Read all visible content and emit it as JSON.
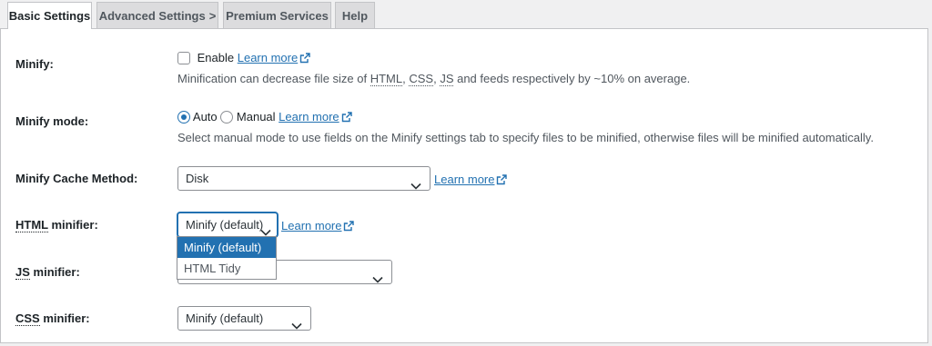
{
  "tabs": {
    "basic": "Basic Settings",
    "advanced": "Advanced Settings",
    "advanced_chevron": ">",
    "premium": "Premium Services",
    "help": "Help"
  },
  "learn_more": "Learn more",
  "minify": {
    "label": "Minify:",
    "enable_label": "Enable",
    "desc_before": "Minification can decrease file size of ",
    "abbr_html": "HTML",
    "abbr_css": "CSS",
    "abbr_js": "JS",
    "desc_after": " and feeds respectively by ~10% on average."
  },
  "minify_mode": {
    "label": "Minify mode:",
    "auto_label": "Auto",
    "manual_label": "Manual",
    "selected": "Auto",
    "desc": "Select manual mode to use fields on the Minify settings tab to specify files to be minified, otherwise files will be minified automatically."
  },
  "cache_method": {
    "label": "Minify Cache Method:",
    "value": "Disk"
  },
  "html_minifier": {
    "label_abbr": "HTML",
    "label_rest": " minifier:",
    "value": "Minify (default)",
    "options": [
      "Minify (default)",
      "HTML Tidy"
    ]
  },
  "js_minifier": {
    "label_abbr": "JS",
    "label_rest": " minifier:"
  },
  "css_minifier": {
    "label_abbr": "CSS",
    "label_rest": " minifier:",
    "value": "Minify (default)"
  },
  "colors": {
    "link": "#2271b1",
    "selected_option_bg": "#2271b1"
  },
  "icons": [
    "external-link-icon",
    "chevron-down-icon",
    "chevron-right-icon"
  ]
}
